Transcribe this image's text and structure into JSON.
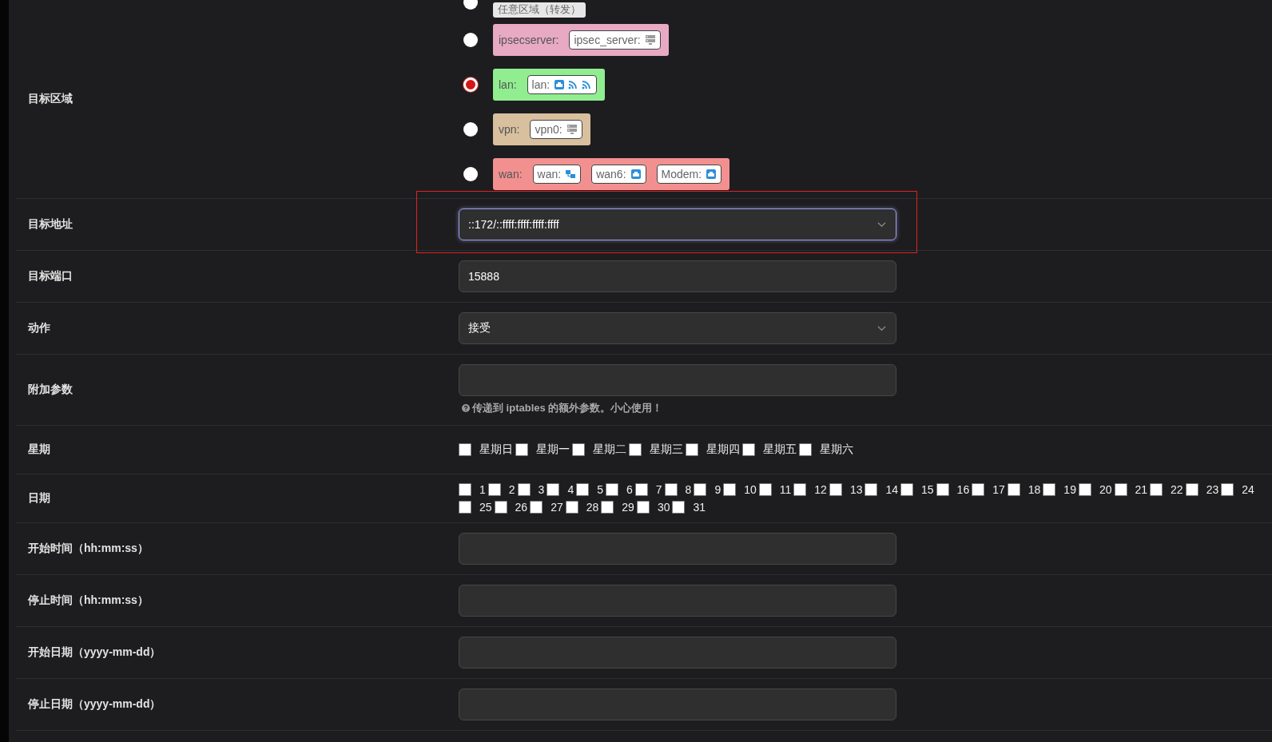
{
  "fields": [
    {
      "kind": "zones",
      "label": "目标区域",
      "zones": [
        {
          "name": "任意区域（转发）",
          "color": "#e6e6e6",
          "selected": false
        },
        {
          "name": "ipsecserver:",
          "color": "#e8a9c3",
          "selected": false,
          "networks": [
            {
              "label": "ipsec_server:",
              "devices": [
                {
                  "kind": "server"
                }
              ]
            }
          ]
        },
        {
          "name": "lan:",
          "color": "#90ee90",
          "selected": true,
          "networks": [
            {
              "label": "lan:",
              "devices": [
                {
                  "kind": "ethernet"
                },
                {
                  "kind": "wifi"
                },
                {
                  "kind": "wifi"
                }
              ]
            }
          ]
        },
        {
          "name": "vpn:",
          "color": "#d8bf9e",
          "selected": false,
          "networks": [
            {
              "label": "vpn0:",
              "devices": [
                {
                  "kind": "server"
                }
              ]
            }
          ]
        },
        {
          "name": "wan:",
          "color": "#f29090",
          "selected": false,
          "networks": [
            {
              "label": "wan:",
              "devices": [
                {
                  "kind": "network"
                }
              ]
            },
            {
              "label": "wan6:",
              "devices": [
                {
                  "kind": "ethernet"
                }
              ]
            },
            {
              "label": "Modem:",
              "devices": [
                {
                  "kind": "ethernet"
                }
              ]
            }
          ]
        }
      ]
    },
    {
      "kind": "select",
      "label": "目标地址",
      "value": "::172/::ffff:ffff:ffff:ffff",
      "focused": true,
      "highlighted": true
    },
    {
      "kind": "text",
      "label": "目标端口",
      "value": "15888"
    },
    {
      "kind": "select",
      "label": "动作",
      "value": "接受"
    },
    {
      "kind": "text",
      "label": "附加参数",
      "help": "传递到 iptables 的额外参数。小心使用！"
    },
    {
      "kind": "checks",
      "label": "星期",
      "options": [
        {
          "label": "星期日",
          "checked": false
        },
        {
          "label": "星期一",
          "checked": false
        },
        {
          "label": "星期二",
          "checked": false
        },
        {
          "label": "星期三",
          "checked": false
        },
        {
          "label": "星期四",
          "checked": false
        },
        {
          "label": "星期五",
          "checked": false
        },
        {
          "label": "星期六",
          "checked": false
        }
      ]
    },
    {
      "kind": "checks",
      "label": "日期",
      "options": [
        {
          "label": "1",
          "checked": false
        },
        {
          "label": "2",
          "checked": false
        },
        {
          "label": "3",
          "checked": false
        },
        {
          "label": "4",
          "checked": false
        },
        {
          "label": "5",
          "checked": false
        },
        {
          "label": "6",
          "checked": false
        },
        {
          "label": "7",
          "checked": false
        },
        {
          "label": "8",
          "checked": false
        },
        {
          "label": "9",
          "checked": false
        },
        {
          "label": "10",
          "checked": false
        },
        {
          "label": "11",
          "checked": false
        },
        {
          "label": "12",
          "checked": false
        },
        {
          "label": "13",
          "checked": false
        },
        {
          "label": "14",
          "checked": false
        },
        {
          "label": "15",
          "checked": false
        },
        {
          "label": "16",
          "checked": false
        },
        {
          "label": "17",
          "checked": false
        },
        {
          "label": "18",
          "checked": false
        },
        {
          "label": "19",
          "checked": false
        },
        {
          "label": "20",
          "checked": false
        },
        {
          "label": "21",
          "checked": false
        },
        {
          "label": "22",
          "checked": false
        },
        {
          "label": "23",
          "checked": false
        },
        {
          "label": "24",
          "checked": false
        },
        {
          "label": "25",
          "checked": false
        },
        {
          "label": "26",
          "checked": false
        },
        {
          "label": "27",
          "checked": false
        },
        {
          "label": "28",
          "checked": false
        },
        {
          "label": "29",
          "checked": false
        },
        {
          "label": "30",
          "checked": false
        },
        {
          "label": "31",
          "checked": false
        }
      ]
    },
    {
      "kind": "text",
      "label": "开始时间（hh:mm:ss）"
    },
    {
      "kind": "text",
      "label": "停止时间（hh:mm:ss）"
    },
    {
      "kind": "text",
      "label": "开始日期（yyyy-mm-dd）"
    },
    {
      "kind": "text",
      "label": "停止日期（yyyy-mm-dd）"
    }
  ]
}
